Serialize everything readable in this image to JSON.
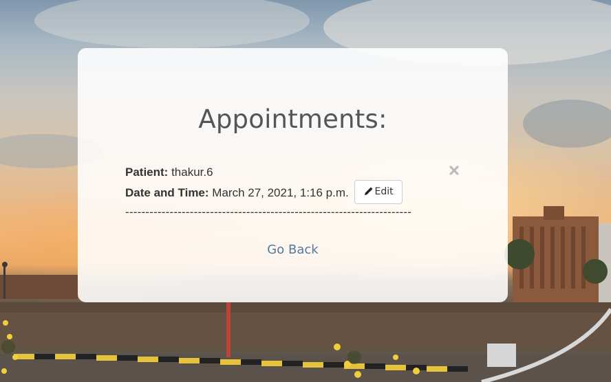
{
  "page": {
    "title": "Appointments:",
    "go_back_label": "Go Back"
  },
  "appointment": {
    "patient_label": "Patient:",
    "patient_value": " thakur.6",
    "datetime_label": "Date and Time:",
    "datetime_value": " March 27, 2021, 1:16 p.m.",
    "edit_label": "Edit",
    "divider": "-----------------------------------------------------------------------"
  },
  "icons": {
    "edit": "pencil-icon",
    "delete": "close-icon"
  },
  "colors": {
    "link": "#4f7aa0",
    "text": "#333333",
    "title": "#555555",
    "icon_muted": "#bbbbbb"
  }
}
